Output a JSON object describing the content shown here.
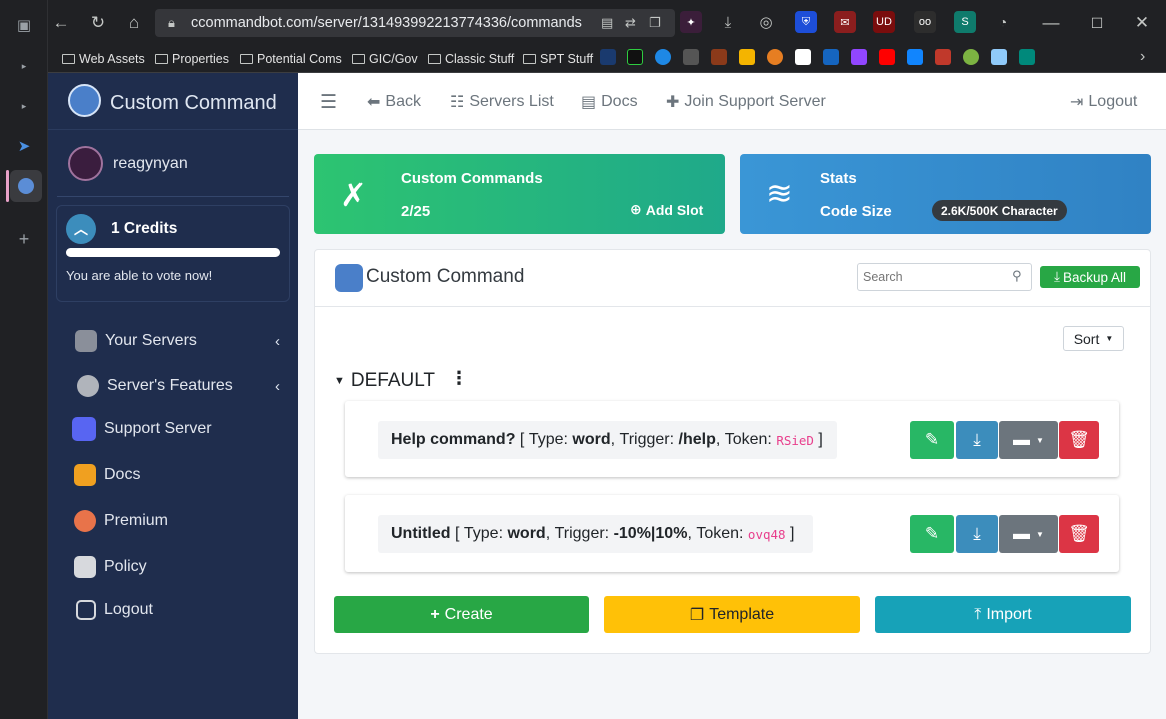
{
  "browser": {
    "url": "ccommandbot.com/server/1314939922137743​36/commands",
    "bookmarks": [
      "Web Assets",
      "Properties",
      "Potential Coms",
      "GIC/Gov",
      "Classic Stuff",
      "SPT Stuff"
    ]
  },
  "brand": {
    "title": "Custom Command"
  },
  "user": {
    "name": "reagynyan"
  },
  "credits": {
    "label": "1 Credits",
    "vote_text": "You are able to vote now!"
  },
  "sidebar": {
    "items": [
      {
        "label": "Your Servers",
        "icon": "server-icon"
      },
      {
        "label": "Server's Features",
        "icon": "gauge-icon"
      },
      {
        "label": "Support Server",
        "icon": "discord-icon"
      },
      {
        "label": "Docs",
        "icon": "docs-icon"
      },
      {
        "label": "Premium",
        "icon": "premium-icon"
      },
      {
        "label": "Policy",
        "icon": "scroll-icon"
      },
      {
        "label": "Logout",
        "icon": "logout-icon"
      }
    ]
  },
  "navbar": {
    "back": "Back",
    "servers_list": "Servers List",
    "docs": "Docs",
    "join_support": "Join Support Server",
    "logout": "Logout"
  },
  "cards": {
    "commands": {
      "title": "Custom Commands",
      "value": "2/25",
      "add_slot": "Add Slot"
    },
    "stats": {
      "title": "Stats",
      "code_size_label": "Code Size",
      "code_size_value": "2.6K/500K Character"
    }
  },
  "panel": {
    "title": "Custom Command",
    "search_placeholder": "Search",
    "backup_all": "Backup All",
    "sort": "Sort",
    "group": "DEFAULT"
  },
  "commands": [
    {
      "name": "Help command?",
      "type_label": "Type:",
      "type": "word",
      "trigger_label": "Trigger:",
      "trigger": "/help",
      "token_label": "Token:",
      "token": "RSieD"
    },
    {
      "name": "Untitled",
      "type_label": "Type:",
      "type": "word",
      "trigger_label": "Trigger:",
      "trigger": "-10%|10%",
      "token_label": "Token:",
      "token": "ovq48"
    }
  ],
  "actions": {
    "create": "Create",
    "template": "Template",
    "import": "Import"
  },
  "colors": {
    "sidebar": "#1f2d4d",
    "green": "#28a745",
    "blue": "#3c8dbc",
    "gray": "#6c757d",
    "red": "#dc3545",
    "yellow": "#ffc107",
    "teal": "#17a2b8"
  }
}
